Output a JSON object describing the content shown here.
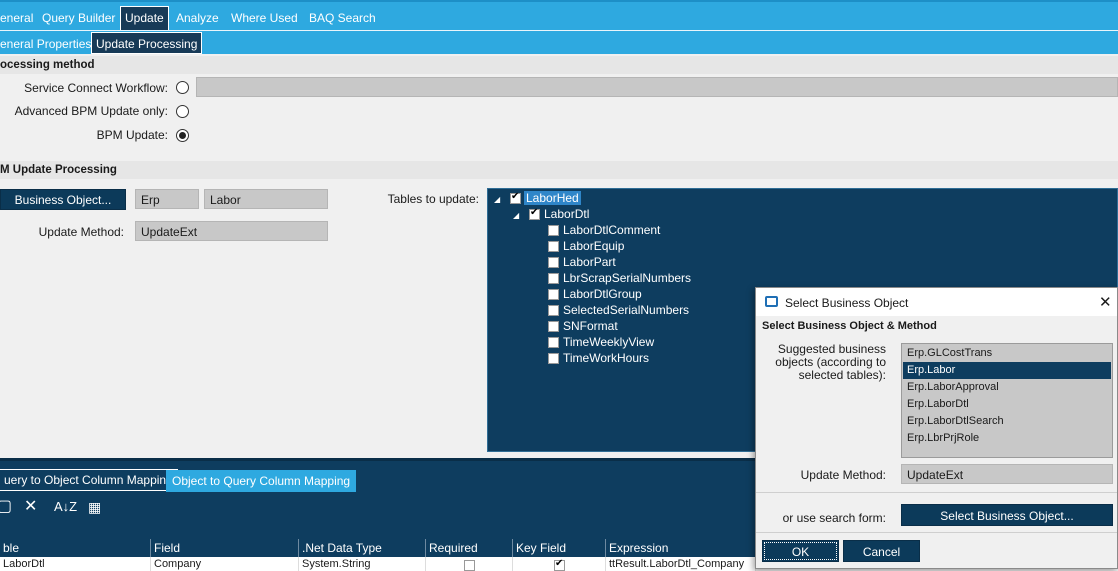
{
  "tabs": {
    "top": [
      "eneral",
      "Query Builder",
      "Update",
      "Analyze",
      "Where Used",
      "BAQ Search"
    ],
    "sub": [
      "eneral Properties",
      "Update  Processing"
    ]
  },
  "processing": {
    "header": "ocessing method",
    "service_connect_label": "Service Connect Workflow:",
    "advanced_bpm_label": "Advanced BPM Update only:",
    "bpm_label": "BPM Update:"
  },
  "bpm_update": {
    "header": "M Update Processing",
    "business_object_button": "Business Object...",
    "prefix_value": "Erp",
    "object_value": "Labor",
    "update_method_label": "Update Method:",
    "update_method_value": "UpdateExt",
    "tables_label": "Tables to update:"
  },
  "tree": {
    "root": "LaborHed",
    "child": "LaborDtl",
    "leaves": [
      "LaborDtlComment",
      "LaborEquip",
      "LaborPart",
      "LbrScrapSerialNumbers",
      "LaborDtlGroup",
      "SelectedSerialNumbers",
      "SNFormat",
      "TimeWeeklyView",
      "TimeWorkHours"
    ]
  },
  "mapping": {
    "tab_query_to_object": "uery to Object Column Mapping",
    "tab_object_to_query": "Object to Query Column Mapping",
    "columns": [
      "ble",
      "Field",
      ".Net Data Type",
      "Required",
      "Key Field",
      "Expression"
    ],
    "row": [
      "LaborDtl",
      "Company",
      "System.String",
      "",
      "",
      "ttResult.LaborDtl_Company"
    ]
  },
  "dialog": {
    "title": "Select Business Object",
    "subtitle": "Select Business Object & Method",
    "suggested_label_1": "Suggested business",
    "suggested_label_2": "objects (according to",
    "suggested_label_3": "selected tables):",
    "objects": [
      "Erp.GLCostTrans",
      "Erp.Labor",
      "Erp.LaborApproval",
      "Erp.LaborDtl",
      "Erp.LaborDtlSearch",
      "Erp.LbrPrjRole"
    ],
    "selected_object": "Erp.Labor",
    "update_method_label": "Update Method:",
    "update_method_value": "UpdateExt",
    "search_label": "or use search form:",
    "search_button": "Select Business Object...",
    "ok": "OK",
    "cancel": "Cancel",
    "close": "✕"
  },
  "colors": {
    "accent": "#2ea9e0",
    "dark_navy": "#0e3d5f",
    "selection": "#2f86c9"
  }
}
